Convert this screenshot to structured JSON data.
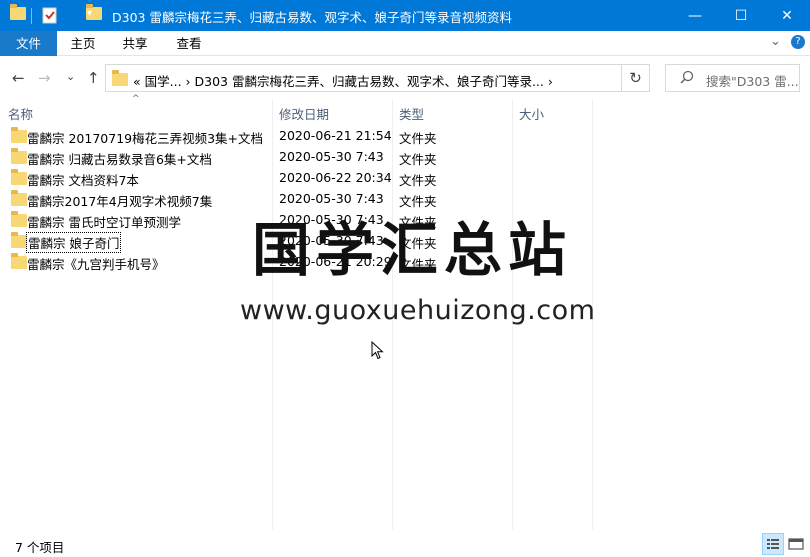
{
  "window": {
    "title": "D303 雷麟宗梅花三弄、归藏古易数、观字术、娘子奇门等录音视频资料",
    "minimize_glyph": "—",
    "maximize_glyph": "☐",
    "close_glyph": "✕",
    "accent": "#0078d7"
  },
  "ribbon": {
    "tabs": [
      "文件",
      "主页",
      "共享",
      "查看"
    ],
    "expand_glyph": "⌄",
    "help_glyph": "?"
  },
  "nav": {
    "back": "←",
    "forward": "→",
    "recent": "⌄",
    "up": "↑"
  },
  "address": {
    "crumbs": "«  国学...  ›  D303 雷麟宗梅花三弄、归藏古易数、观字术、娘子奇门等录...  ›",
    "dropdown": "⌄",
    "refresh": "↻"
  },
  "search": {
    "icon": "⌕",
    "placeholder": "搜索\"D303 雷..."
  },
  "columns": {
    "name": "名称",
    "date": "修改日期",
    "type": "类型",
    "size": "大小",
    "sort_glyph": "^"
  },
  "files": [
    {
      "name": "雷麟宗 20170719梅花三弄视频3集+文档",
      "date": "2020-06-21 21:54",
      "type": "文件夹"
    },
    {
      "name": "雷麟宗 归藏古易数录音6集+文档",
      "date": "2020-05-30 7:43",
      "type": "文件夹"
    },
    {
      "name": "雷麟宗 文档资料7本",
      "date": "2020-06-22 20:34",
      "type": "文件夹"
    },
    {
      "name": "雷麟宗2017年4月观字术视频7集",
      "date": "2020-05-30 7:43",
      "type": "文件夹"
    },
    {
      "name": "雷麟宗 雷氏时空订单预测学",
      "date": "2020-05-30 7:43",
      "type": "文件夹"
    },
    {
      "name": "雷麟宗 娘子奇门",
      "date": "2020-05-30 7:43",
      "type": "文件夹"
    },
    {
      "name": "雷麟宗《九宫判手机号》",
      "date": "2020-06-21 20:29",
      "type": "文件夹"
    }
  ],
  "watermark": {
    "cn": "国学汇总站",
    "url": "www.guoxuehuizong.com"
  },
  "status": {
    "count": "7 个项目"
  }
}
